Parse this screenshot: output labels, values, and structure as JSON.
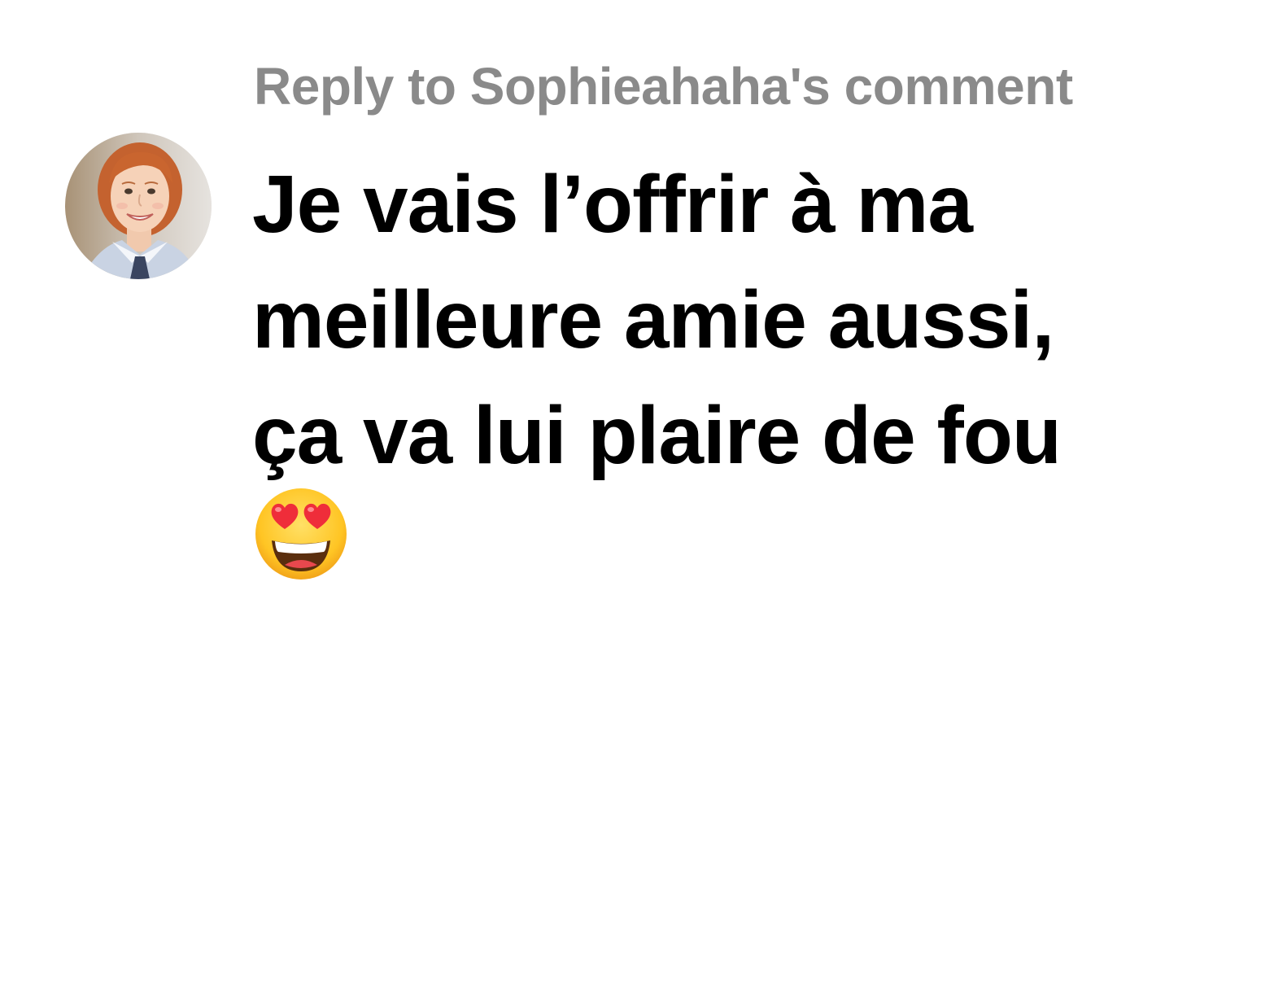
{
  "reply": {
    "header": "Reply to Sophieahaha's comment",
    "avatar_icon": "user-avatar-photo",
    "comment_lines": [
      "Je vais l’offrir à ma",
      "meilleure amie aussi,",
      "ça va lui plaire de fou"
    ],
    "emoji_icon": "smiling-face-with-heart-eyes-icon"
  },
  "colors": {
    "header_text": "#8a8a8a",
    "comment_text": "#000000",
    "background": "#ffffff"
  }
}
